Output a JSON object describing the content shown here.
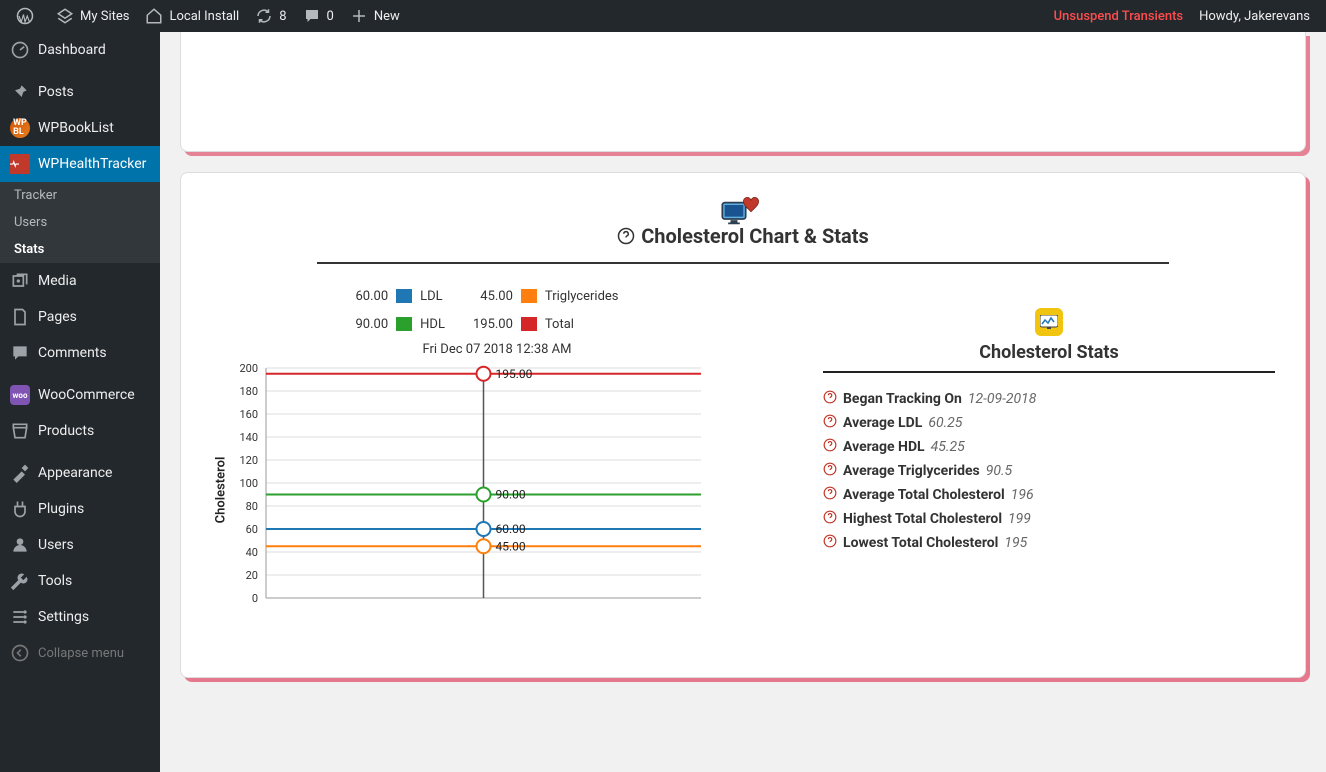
{
  "adminbar": {
    "mysites": "My Sites",
    "local": "Local Install",
    "updates": "8",
    "comments": "0",
    "new": "New",
    "unsuspend": "Unsuspend Transients",
    "howdy": "Howdy, Jakerevans"
  },
  "sidebar": {
    "dashboard": "Dashboard",
    "posts": "Posts",
    "wpbooklist": "WPBookList",
    "wphealthtracker": "WPHealthTracker",
    "sub": {
      "tracker": "Tracker",
      "users": "Users",
      "stats": "Stats"
    },
    "media": "Media",
    "pages": "Pages",
    "comments": "Comments",
    "woocommerce": "WooCommerce",
    "products": "Products",
    "appearance": "Appearance",
    "plugins": "Plugins",
    "users": "Users",
    "tools": "Tools",
    "settings": "Settings",
    "collapse": "Collapse menu"
  },
  "panel": {
    "title": "Cholesterol Chart & Stats",
    "date": "Fri Dec 07 2018 12:38 AM",
    "ylabel": "Cholesterol"
  },
  "legend": {
    "ldl": {
      "val": "60.00",
      "label": "LDL"
    },
    "hdl": {
      "val": "90.00",
      "label": "HDL"
    },
    "trig": {
      "val": "45.00",
      "label": "Triglycerides"
    },
    "total": {
      "val": "195.00",
      "label": "Total"
    }
  },
  "colors": {
    "ldl": "#1f77b4",
    "hdl": "#2ca02c",
    "trig": "#ff7f0e",
    "total": "#d62728"
  },
  "yticks": [
    "200",
    "180",
    "160",
    "140",
    "120",
    "100",
    "80",
    "60",
    "40",
    "20",
    "0"
  ],
  "stats": {
    "title": "Cholesterol Stats",
    "items": [
      {
        "label": "Began Tracking On",
        "value": "12-09-2018"
      },
      {
        "label": "Average LDL",
        "value": "60.25"
      },
      {
        "label": "Average HDL",
        "value": "45.25"
      },
      {
        "label": "Average Triglycerides",
        "value": "90.5"
      },
      {
        "label": "Average Total Cholesterol",
        "value": "196"
      },
      {
        "label": "Highest Total Cholesterol",
        "value": "199"
      },
      {
        "label": "Lowest Total Cholesterol",
        "value": "195"
      }
    ]
  },
  "chart_data": {
    "type": "line",
    "title": "Cholesterol Chart & Stats",
    "xlabel": "",
    "ylabel": "Cholesterol",
    "ylim": [
      0,
      200
    ],
    "x": [
      0,
      1,
      2
    ],
    "hover_index": 1,
    "hover_date": "Fri Dec 07 2018 12:38 AM",
    "series": [
      {
        "name": "LDL",
        "color": "#1f77b4",
        "values": [
          60,
          60,
          60
        ]
      },
      {
        "name": "HDL",
        "color": "#2ca02c",
        "values": [
          90,
          90,
          90
        ]
      },
      {
        "name": "Triglycerides",
        "color": "#ff7f0e",
        "values": [
          45,
          45,
          45
        ]
      },
      {
        "name": "Total",
        "color": "#d62728",
        "values": [
          195,
          195,
          195
        ]
      }
    ],
    "hover_labels": {
      "LDL": "60.00",
      "HDL": "90.00",
      "Triglycerides": "45.00",
      "Total": "195.00"
    }
  }
}
